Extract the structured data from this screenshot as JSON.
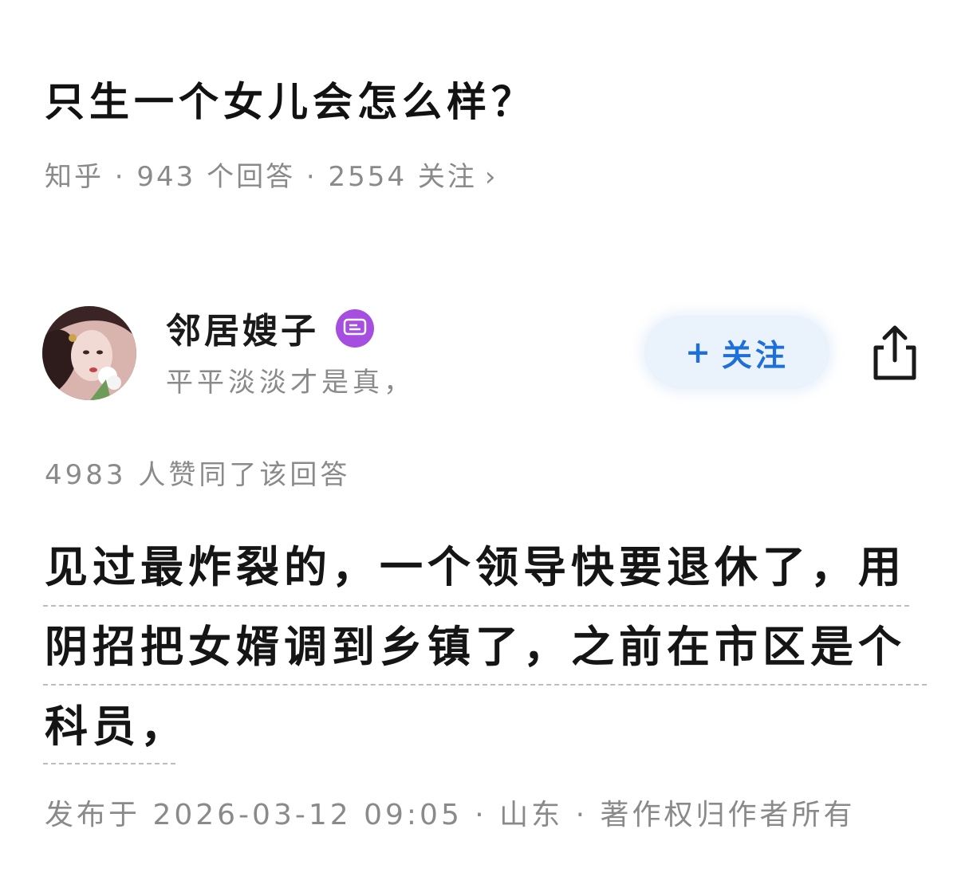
{
  "question": {
    "title": "只生一个女儿会怎么样？",
    "meta": "知乎 · 943 个回答 · 2554 关注",
    "meta_chevron": "›"
  },
  "author": {
    "name": "邻居嫂子",
    "bio": "平平淡淡才是真，",
    "badge_icon": "message-badge-icon",
    "follow_label": "关注",
    "follow_plus": "+"
  },
  "answer": {
    "vote_text": "4983 人赞同了该回答",
    "lines": [
      "见过最炸裂的，一个领导快要退休了，用",
      "阴招把女婿调到乡镇了，之前在市区是个",
      "科员，"
    ],
    "publish_info": "发布于 2026-03-12 09:05 · 山东 · 著作权归作者所有"
  },
  "colors": {
    "accent": "#1e6fd9",
    "badge": "#a54ee0",
    "muted": "#8a8a8a"
  }
}
